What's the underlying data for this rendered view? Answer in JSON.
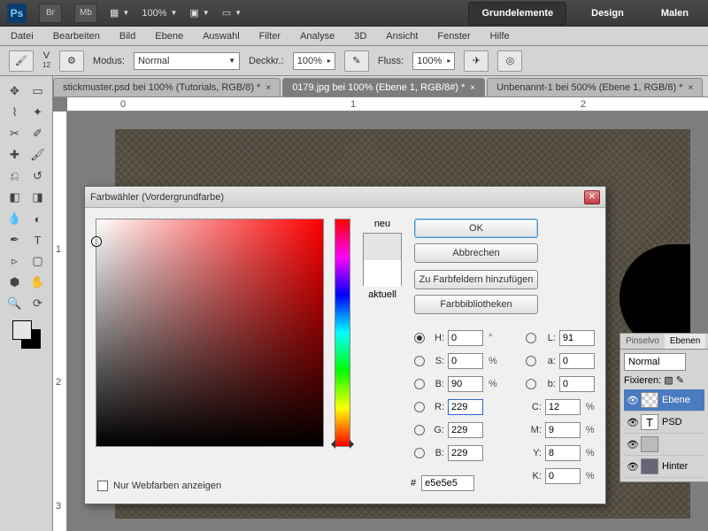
{
  "topbar": {
    "logo": "Ps",
    "btn1": "Br",
    "btn2": "Mb",
    "zoom": "100%",
    "ws_active": "Grundelemente",
    "ws_design": "Design",
    "ws_malen": "Malen"
  },
  "menu": {
    "datei": "Datei",
    "bearbeiten": "Bearbeiten",
    "bild": "Bild",
    "ebene": "Ebene",
    "auswahl": "Auswahl",
    "filter": "Filter",
    "analyse": "Analyse",
    "drei_d": "3D",
    "ansicht": "Ansicht",
    "fenster": "Fenster",
    "hilfe": "Hilfe"
  },
  "options": {
    "airbrush": "V",
    "airbrush_sub": "12",
    "modus_label": "Modus:",
    "modus_value": "Normal",
    "deckkraft_label": "Deckkr.:",
    "deckkraft_value": "100%",
    "fluss_label": "Fluss:",
    "fluss_value": "100%"
  },
  "documents": {
    "tab1": "stickmuster.psd bei 100% (Tutorials, RGB/8) *",
    "tab2": "0179.jpg bei 100% (Ebene 1, RGB/8#) *",
    "tab3": "Unbenannt-1 bei 500% (Ebene 1, RGB/8) *"
  },
  "ruler": {
    "h0": "0",
    "h1": "1",
    "h2": "2",
    "v1": "1",
    "v2": "2",
    "v3": "3"
  },
  "layers": {
    "tab_pinsel": "Pinselvo",
    "tab_ebenen": "Ebenen",
    "blend": "Normal",
    "fixieren": "Fixieren:",
    "l1": "Ebene",
    "l2": "PSD",
    "l3": "",
    "l4": "Hinter"
  },
  "picker": {
    "title": "Farbwähler (Vordergrundfarbe)",
    "neu": "neu",
    "aktuell": "aktuell",
    "ok": "OK",
    "abbrechen": "Abbrechen",
    "zu_farbfeldern": "Zu Farbfeldern hinzufügen",
    "farbbib": "Farbbibliotheken",
    "H": "0",
    "S": "0",
    "B": "90",
    "R": "229",
    "G": "229",
    "Bv": "229",
    "L": "91",
    "a": "0",
    "b": "0",
    "C": "12",
    "M": "9",
    "Y": "8",
    "K": "0",
    "hex": "e5e5e5",
    "webonly": "Nur Webfarben anzeigen",
    "deg": "°",
    "pct": "%",
    "hash": "#",
    "lbl_H": "H:",
    "lbl_S": "S:",
    "lbl_B": "B:",
    "lbl_R": "R:",
    "lbl_G": "G:",
    "lbl_Bv": "B:",
    "lbl_L": "L:",
    "lbl_a": "a:",
    "lbl_b": "b:",
    "lbl_C": "C:",
    "lbl_M": "M:",
    "lbl_Y": "Y:",
    "lbl_K": "K:"
  }
}
